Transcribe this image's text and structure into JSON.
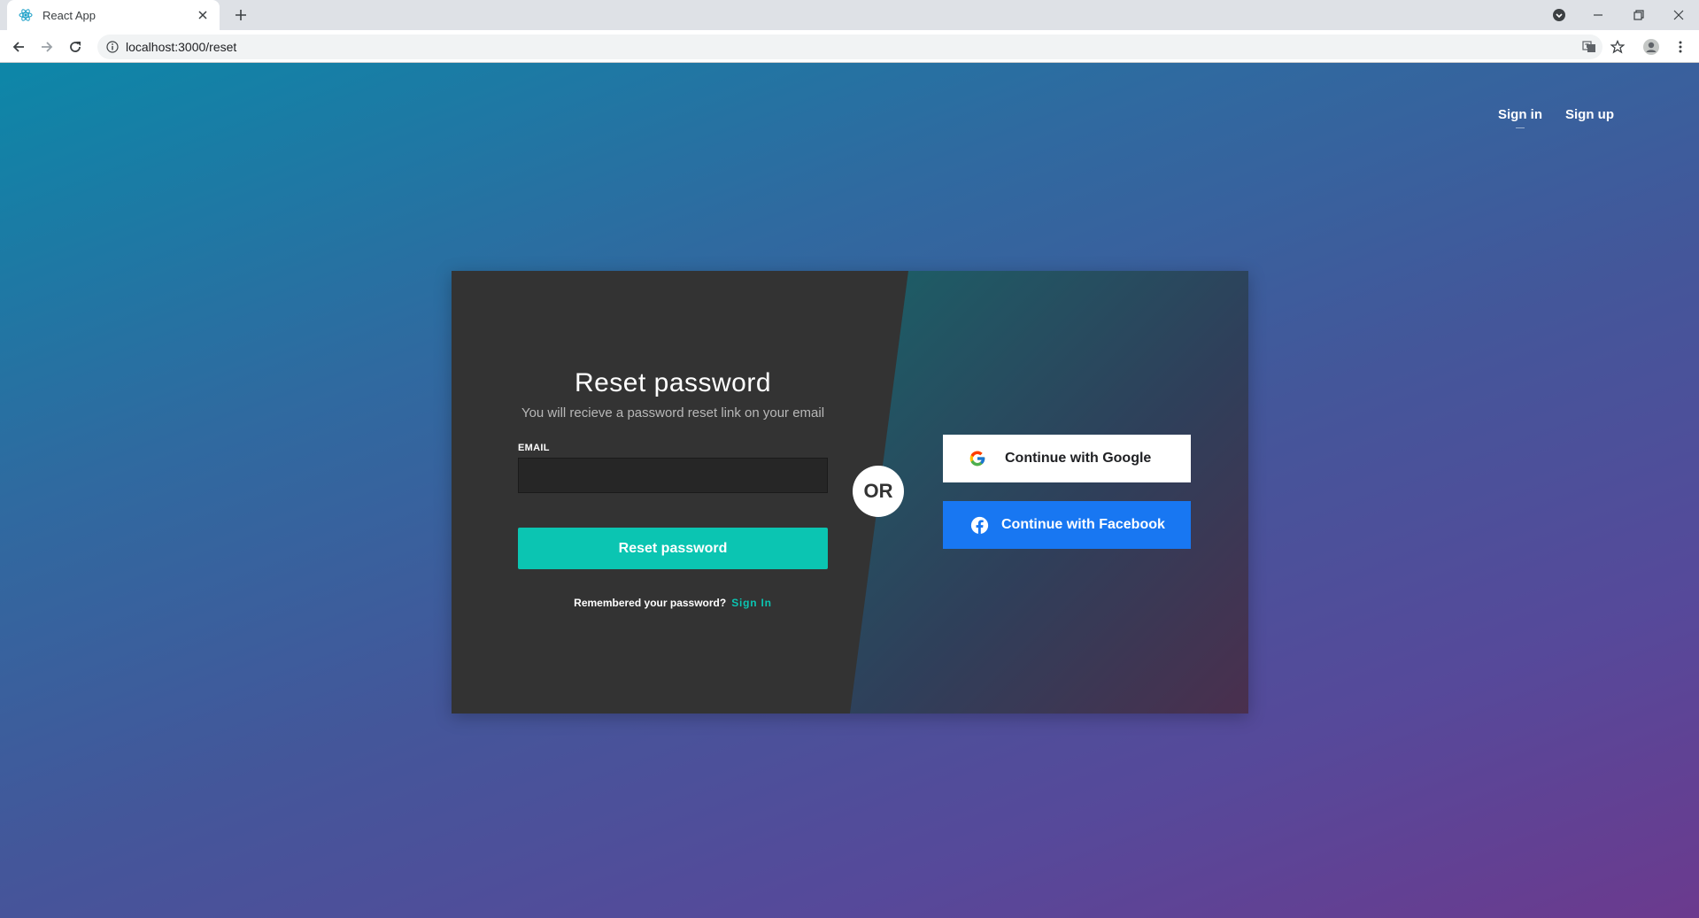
{
  "browser": {
    "tab_title": "React App",
    "url": "localhost:3000/reset"
  },
  "nav": {
    "sign_in": "Sign in",
    "sign_up": "Sign up"
  },
  "form": {
    "title": "Reset password",
    "subtitle": "You will recieve a password reset link on your email",
    "email_label": "EMAIL",
    "email_value": "",
    "submit_label": "Reset password",
    "remember_text": "Remembered your password?",
    "sign_in_link": "Sign In"
  },
  "divider": {
    "label": "OR"
  },
  "social": {
    "google_label": "Continue with Google",
    "facebook_label": "Continue with Facebook"
  },
  "colors": {
    "accent": "#0bc5b2",
    "facebook": "#1877f2",
    "card_left": "#333333"
  }
}
